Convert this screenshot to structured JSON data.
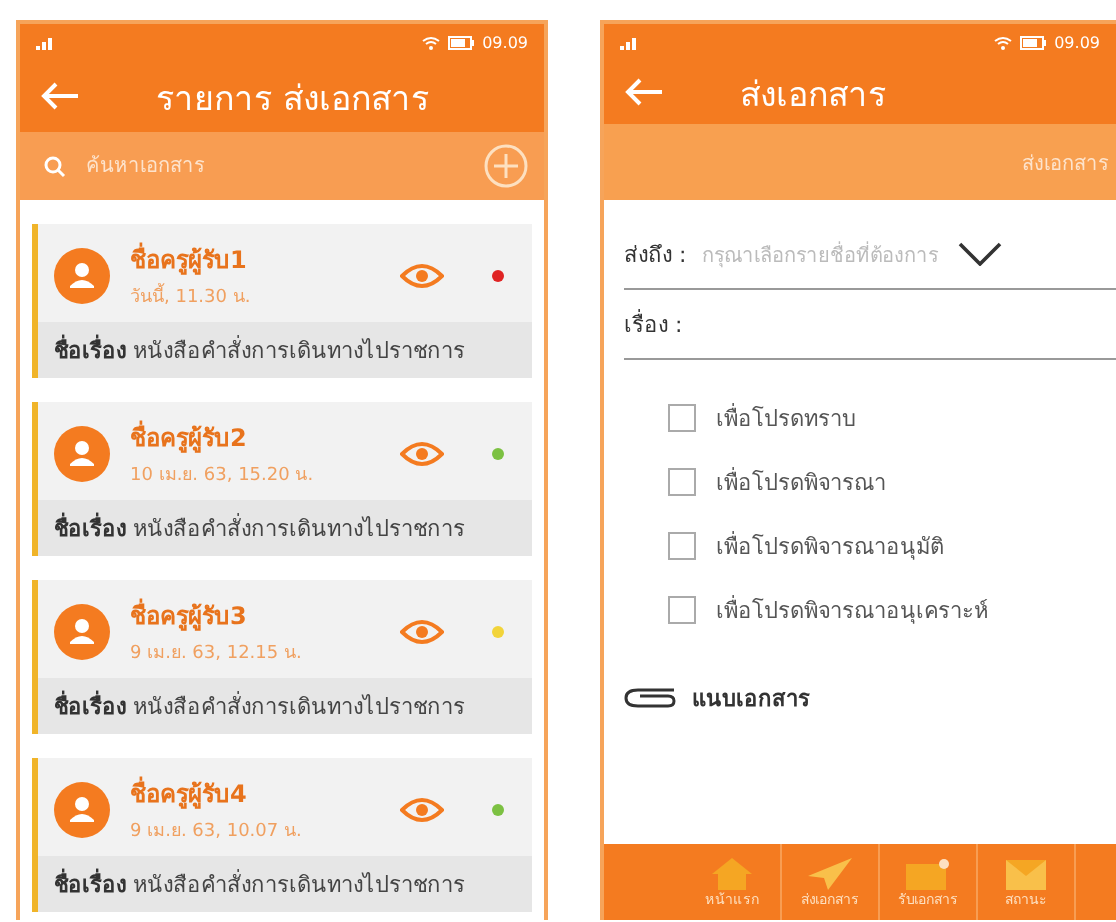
{
  "list_screen": {
    "status_time": "09.09",
    "title": "รายการ ส่งเอกสาร",
    "search": {
      "placeholder": "ค้นหาเอกสาร"
    },
    "items": [
      {
        "recipient": "ชื่อครูผู้รับ1",
        "date": "วันนี้, 11.30 น.",
        "subject_label": "ชื่อเรื่อง",
        "subject": "หนังสือคำสั่งการเดินทางไปราชการ",
        "color": "#e02424"
      },
      {
        "recipient": "ชื่อครูผู้รับ2",
        "date": "10 เม.ย. 63, 15.20 น.",
        "subject_label": "ชื่อเรื่อง",
        "subject": "หนังสือคำสั่งการเดินทางไปราชการ",
        "color": "#7cc142"
      },
      {
        "recipient": "ชื่อครูผู้รับ3",
        "date": "9 เม.ย. 63, 12.15 น.",
        "subject_label": "ชื่อเรื่อง",
        "subject": "หนังสือคำสั่งการเดินทางไปราชการ",
        "color": "#f2d43a"
      },
      {
        "recipient": "ชื่อครูผู้รับ4",
        "date": "9 เม.ย. 63, 10.07 น.",
        "subject_label": "ชื่อเรื่อง",
        "subject": "หนังสือคำสั่งการเดินทางไปราชการ",
        "color": "#7cc142"
      }
    ]
  },
  "send_screen": {
    "status_time": "09.09",
    "title": "ส่งเอกสาร",
    "tab": "ส่งเอกสาร",
    "to_label": "ส่งถึง :",
    "to_placeholder": "กรุณาเลือกรายชื่อที่ต้องการ",
    "subject_label": "เรื่อง :",
    "options": [
      {
        "label": "เพื่อโปรดทราบ",
        "checked": false
      },
      {
        "label": "เพื่อโปรดพิจารณา",
        "checked": false
      },
      {
        "label": "เพื่อโปรดพิจารณาอนุมัติ",
        "checked": false
      },
      {
        "label": "เพื่อโปรดพิจารณาอนุเคราะห์",
        "checked": false
      }
    ],
    "attach": "แนบเอกสาร",
    "nav": [
      {
        "label": "หน้าแรก",
        "kind": "home"
      },
      {
        "label": "ส่งเอกสาร",
        "kind": "send"
      },
      {
        "label": "รับเอกสาร",
        "kind": "inbox"
      },
      {
        "label": "สถานะ",
        "kind": "status"
      }
    ]
  }
}
